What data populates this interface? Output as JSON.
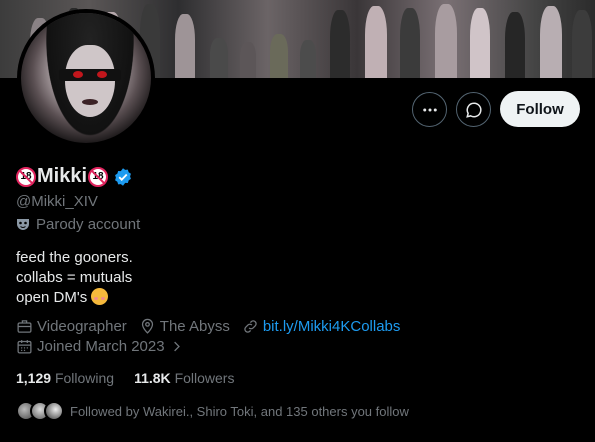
{
  "profile": {
    "display_name": "Mikki",
    "badge_label": "18",
    "handle": "@Mikki_XIV",
    "parody_label": "Parody account",
    "bio": [
      "feed the gooners.",
      "collabs = mutuals",
      "open DM's"
    ],
    "occupation": "Videographer",
    "location": "The Abyss",
    "link": "bit.ly/Mikki4KCollabs",
    "joined": "Joined March 2023"
  },
  "stats": {
    "following_count": "1,129",
    "following_label": "Following",
    "followers_count": "11.8K",
    "followers_label": "Followers"
  },
  "followed_by": "Followed by Wakirei., Shiro Toki, and 135 others you follow",
  "actions": {
    "follow_label": "Follow"
  },
  "icons": {
    "more": "more-icon",
    "message": "message-icon",
    "verified": "verified-icon",
    "parody": "parody-mask-icon",
    "occupation": "briefcase-icon",
    "location": "location-pin-icon",
    "link": "link-icon",
    "joined": "calendar-icon",
    "chevron": "chevron-right-icon"
  },
  "colors": {
    "accent": "#1d9bf0",
    "muted": "#71767b",
    "text": "#e7e9ea",
    "background": "#000000",
    "badge": "#e0245e"
  }
}
